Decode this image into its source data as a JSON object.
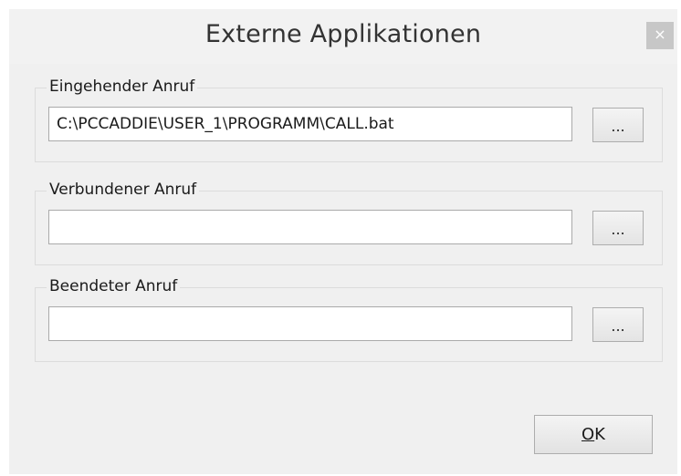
{
  "dialog": {
    "title": "Externe Applikationen",
    "close_label": "×"
  },
  "groups": [
    {
      "label": "Eingehender Anruf",
      "value": "C:\\PCCADDIE\\USER_1\\PROGRAMM\\CALL.bat",
      "browse_label": "..."
    },
    {
      "label": "Verbundener Anruf",
      "value": "",
      "browse_label": "..."
    },
    {
      "label": "Beendeter Anruf",
      "value": "",
      "browse_label": "..."
    }
  ],
  "buttons": {
    "ok_mnemonic": "O",
    "ok_rest": "K"
  },
  "icons": {
    "close": "close-icon"
  },
  "colors": {
    "titlebar_bg": "#f2f2f2",
    "client_bg": "#f0f0f0",
    "close_bg": "#c7c7c7"
  }
}
